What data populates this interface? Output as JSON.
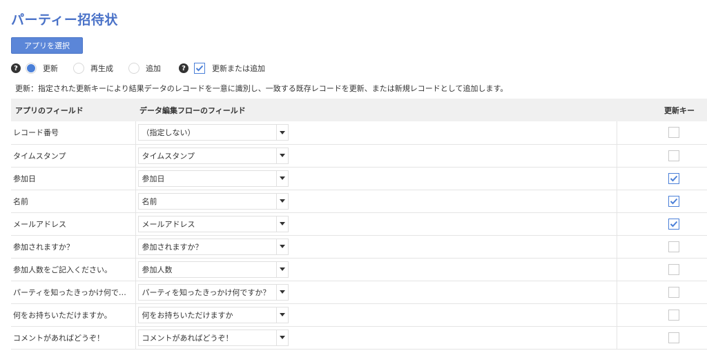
{
  "page": {
    "title": "パーティー招待状",
    "select_app_label": "アプリを選択"
  },
  "mode": {
    "help_glyph": "?",
    "options": [
      {
        "label": "更新",
        "selected": true
      },
      {
        "label": "再生成",
        "selected": false
      },
      {
        "label": "追加",
        "selected": false
      }
    ],
    "update_or_add": {
      "label": "更新または追加",
      "checked": true
    },
    "description": "更新：指定された更新キーにより結果データのレコードを一意に識別し、一致する既存レコードを更新、または新規レコードとして追加します。"
  },
  "table": {
    "headers": {
      "app_field": "アプリのフィールド",
      "flow_field": "データ編集フローのフィールド",
      "update_key": "更新キー"
    },
    "rows": [
      {
        "app_field": "レコード番号",
        "flow_field": "（指定しない）",
        "key": false
      },
      {
        "app_field": "タイムスタンプ",
        "flow_field": "タイムスタンプ",
        "key": false
      },
      {
        "app_field": "参加日",
        "flow_field": "参加日",
        "key": true
      },
      {
        "app_field": "名前",
        "flow_field": "名前",
        "key": true
      },
      {
        "app_field": "メールアドレス",
        "flow_field": "メールアドレス",
        "key": true
      },
      {
        "app_field": "参加されますか？",
        "flow_field": "参加されますか？",
        "key": false
      },
      {
        "app_field": "参加人数をご記入ください。",
        "flow_field": "参加人数",
        "key": false
      },
      {
        "app_field": "パーティを知ったきっかけ何で…",
        "flow_field": "パーティを知ったきっかけ何ですか？",
        "key": false
      },
      {
        "app_field": "何をお持ちいただけますか。",
        "flow_field": "何をお持ちいただけますか",
        "key": false
      },
      {
        "app_field": "コメントがあればどうぞ！",
        "flow_field": "コメントがあればどうぞ！",
        "key": false
      }
    ]
  },
  "colors": {
    "accent": "#4a7fd8",
    "title": "#4a72c8",
    "header_bg": "#f0f0f0"
  }
}
